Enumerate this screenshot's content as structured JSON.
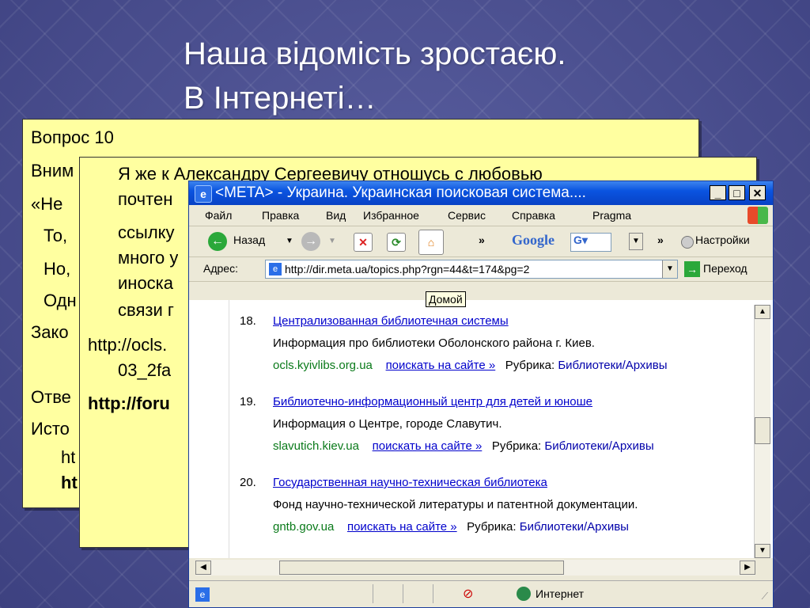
{
  "slide": {
    "title_line1": "Наша відомість зростаєю.",
    "title_line2": "В Інтернеті…"
  },
  "note1": {
    "lines": [
      "Вопрос 10",
      "Вним",
      "«Не",
      "То,",
      "Но,",
      "Одн",
      "Зако",
      "Отве",
      "Исто",
      "ht",
      "ht"
    ]
  },
  "note2": {
    "lines": [
      "Я же к Александру Сергеевичу отношусь с любовью",
      "почтен",
      "ссылку",
      "много у",
      "иноска",
      "связи г",
      "http://ocls.",
      "03_2fa",
      "http://foru"
    ]
  },
  "browser": {
    "title": "<META> - Украина. Украинская поисковая система....",
    "menu": [
      "Файл",
      "Правка",
      "Вид",
      "Избранное",
      "Сервис",
      "Справка",
      "Pragma"
    ],
    "toolbar": {
      "back_label": "Назад",
      "chevron": "»",
      "google_label": "Google",
      "settings_label": "Настройки"
    },
    "address": {
      "label": "Адрес:",
      "url": "http://dir.meta.ua/topics.php?rgn=44&t=174&pg=2",
      "go_label": "Переход"
    },
    "tooltip": "Домой",
    "results": [
      {
        "num": "18.",
        "title": "Централизованная библиотечная системы",
        "desc": "Информация про библиотеки Оболонского района г. Киев.",
        "domain": "ocls.kyivlibs.org.ua",
        "search_link": "поискать на сайте »",
        "rubric_label": "Рубрика:",
        "rubric": "Библиотеки/Архивы"
      },
      {
        "num": "19.",
        "title": "Библиотечно-информационный центр для детей и юноше",
        "desc": "Информация о Центре, городе Славутич.",
        "domain": "slavutich.kiev.ua",
        "search_link": "поискать на сайте »",
        "rubric_label": "Рубрика:",
        "rubric": "Библиотеки/Архивы"
      },
      {
        "num": "20.",
        "title": "Государственная научно-техническая библиотека",
        "desc": "Фонд научно-технической литературы и патентной документации.",
        "domain": "gntb.gov.ua",
        "search_link": "поискать на сайте »",
        "rubric_label": "Рубрика:",
        "rubric": "Библиотеки/Архивы"
      }
    ],
    "status": {
      "zone": "Интернет"
    }
  }
}
